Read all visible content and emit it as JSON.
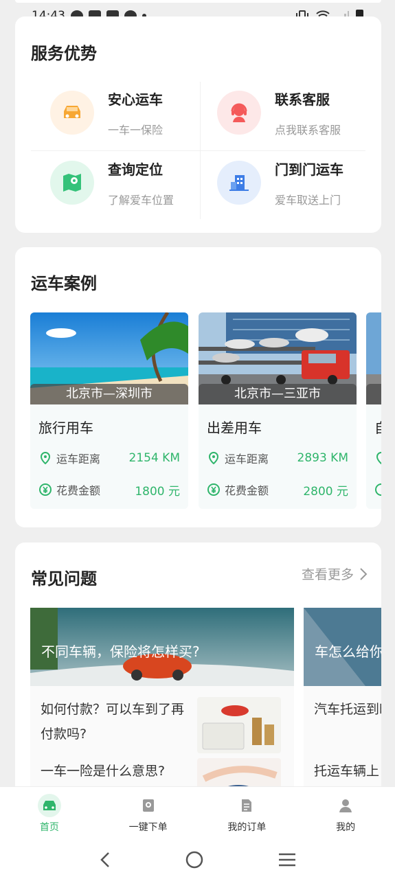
{
  "status_bar": {
    "time": "14:43"
  },
  "services": {
    "title": "服务优势",
    "items": [
      {
        "title": "安心运车",
        "subtitle": "一车一保险",
        "icon": "car-icon",
        "color": "#f7a733",
        "bg": "#fff2e4"
      },
      {
        "title": "联系客服",
        "subtitle": "点我联系客服",
        "icon": "headset-icon",
        "color": "#f45a5a",
        "bg": "#fde8e8"
      },
      {
        "title": "查询定位",
        "subtitle": "了解爱车位置",
        "icon": "map-pin-icon",
        "color": "#35c27a",
        "bg": "#e2f7ec"
      },
      {
        "title": "门到门运车",
        "subtitle": "爱车取送上门",
        "icon": "building-icon",
        "color": "#3d7de6",
        "bg": "#e5eefc"
      }
    ]
  },
  "cases": {
    "title": "运车案例",
    "distance_label": "运车距离",
    "cost_label": "花费金额",
    "items": [
      {
        "route": "北京市—深圳市",
        "name": "旅行用车",
        "distance": "2154 KM",
        "cost": "1800 元"
      },
      {
        "route": "北京市—三亚市",
        "name": "出差用车",
        "distance": "2893 KM",
        "cost": "2800 元"
      },
      {
        "route": "",
        "name": "自",
        "distance": "",
        "cost": ""
      }
    ]
  },
  "faq": {
    "title": "常见问题",
    "more": "查看更多",
    "cards": [
      {
        "header": "不同车辆，保险将怎样买?",
        "questions": [
          "如何付款？可以车到了再付款吗?",
          "一车一险是什么意思?"
        ]
      },
      {
        "header": "车怎么给你",
        "questions": [
          "汽车托运到时有什么需",
          "托运车辆上"
        ]
      }
    ]
  },
  "tabbar": {
    "items": [
      {
        "label": "首页",
        "icon": "car-home-icon",
        "active": true
      },
      {
        "label": "一键下单",
        "icon": "order-icon",
        "active": false
      },
      {
        "label": "我的订单",
        "icon": "document-icon",
        "active": false
      },
      {
        "label": "我的",
        "icon": "user-icon",
        "active": false
      }
    ]
  },
  "colors": {
    "accent": "#2fb56b",
    "background": "#efefef"
  }
}
